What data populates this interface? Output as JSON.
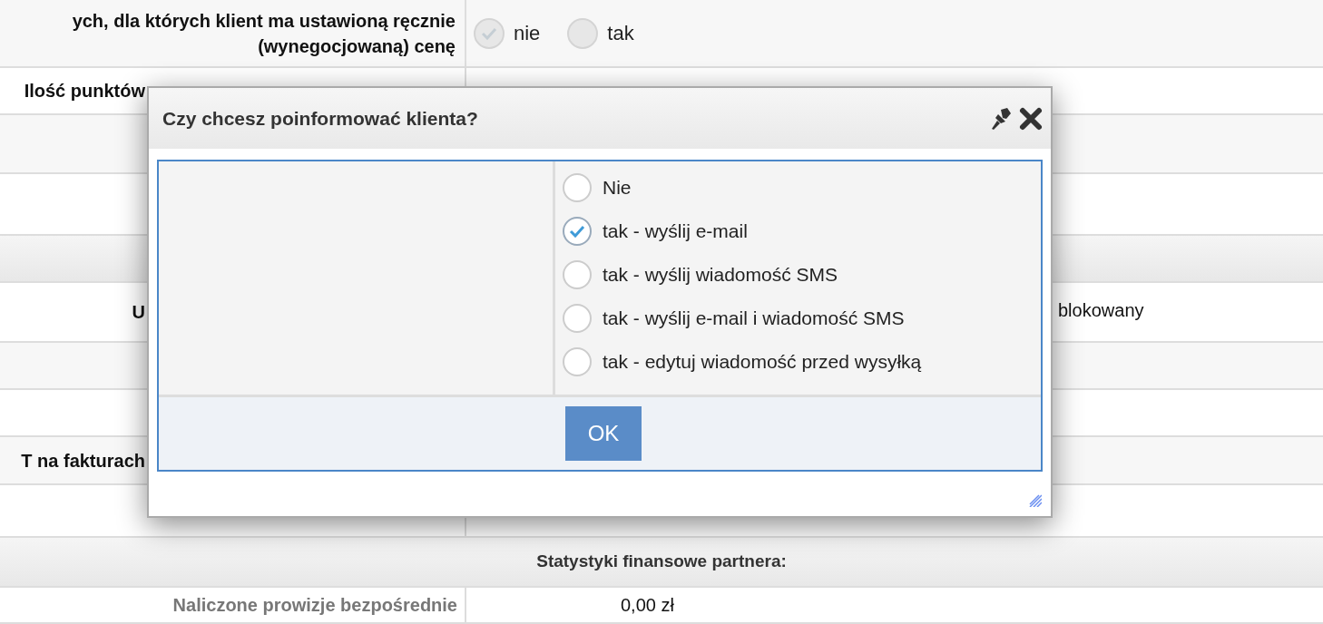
{
  "form_rows": [
    {
      "kind": "radio",
      "label": "ych, dla których klient ma ustawioną ręcznie (wynegocjowaną) cenę",
      "options": [
        {
          "label": "nie",
          "checked": true,
          "disabled": true
        },
        {
          "label": "tak",
          "checked": false,
          "disabled": true
        }
      ]
    },
    {
      "kind": "cut",
      "label": "Ilość punktów"
    },
    {
      "kind": "empty"
    },
    {
      "kind": "empty"
    },
    {
      "kind": "header"
    },
    {
      "kind": "cut",
      "label": "U",
      "value": "blokowany"
    },
    {
      "kind": "empty"
    },
    {
      "kind": "empty"
    },
    {
      "kind": "cut",
      "label": "T na fakturach"
    },
    {
      "kind": "empty"
    },
    {
      "kind": "header",
      "label": "Statystyki finansowe partnera:"
    },
    {
      "kind": "text",
      "label": "Naliczone prowizje bezpośrednie",
      "value": "0,00 zł"
    }
  ],
  "dialog": {
    "title": "Czy chcesz poinformować klienta?",
    "options": [
      {
        "label": "Nie",
        "selected": false
      },
      {
        "label": "tak - wyślij e-mail",
        "selected": true
      },
      {
        "label": "tak - wyślij wiadomość SMS",
        "selected": false
      },
      {
        "label": "tak - wyślij e-mail i wiadomość SMS",
        "selected": false
      },
      {
        "label": "tak - edytuj wiadomość przed wysyłką",
        "selected": false
      }
    ],
    "button": "OK"
  }
}
